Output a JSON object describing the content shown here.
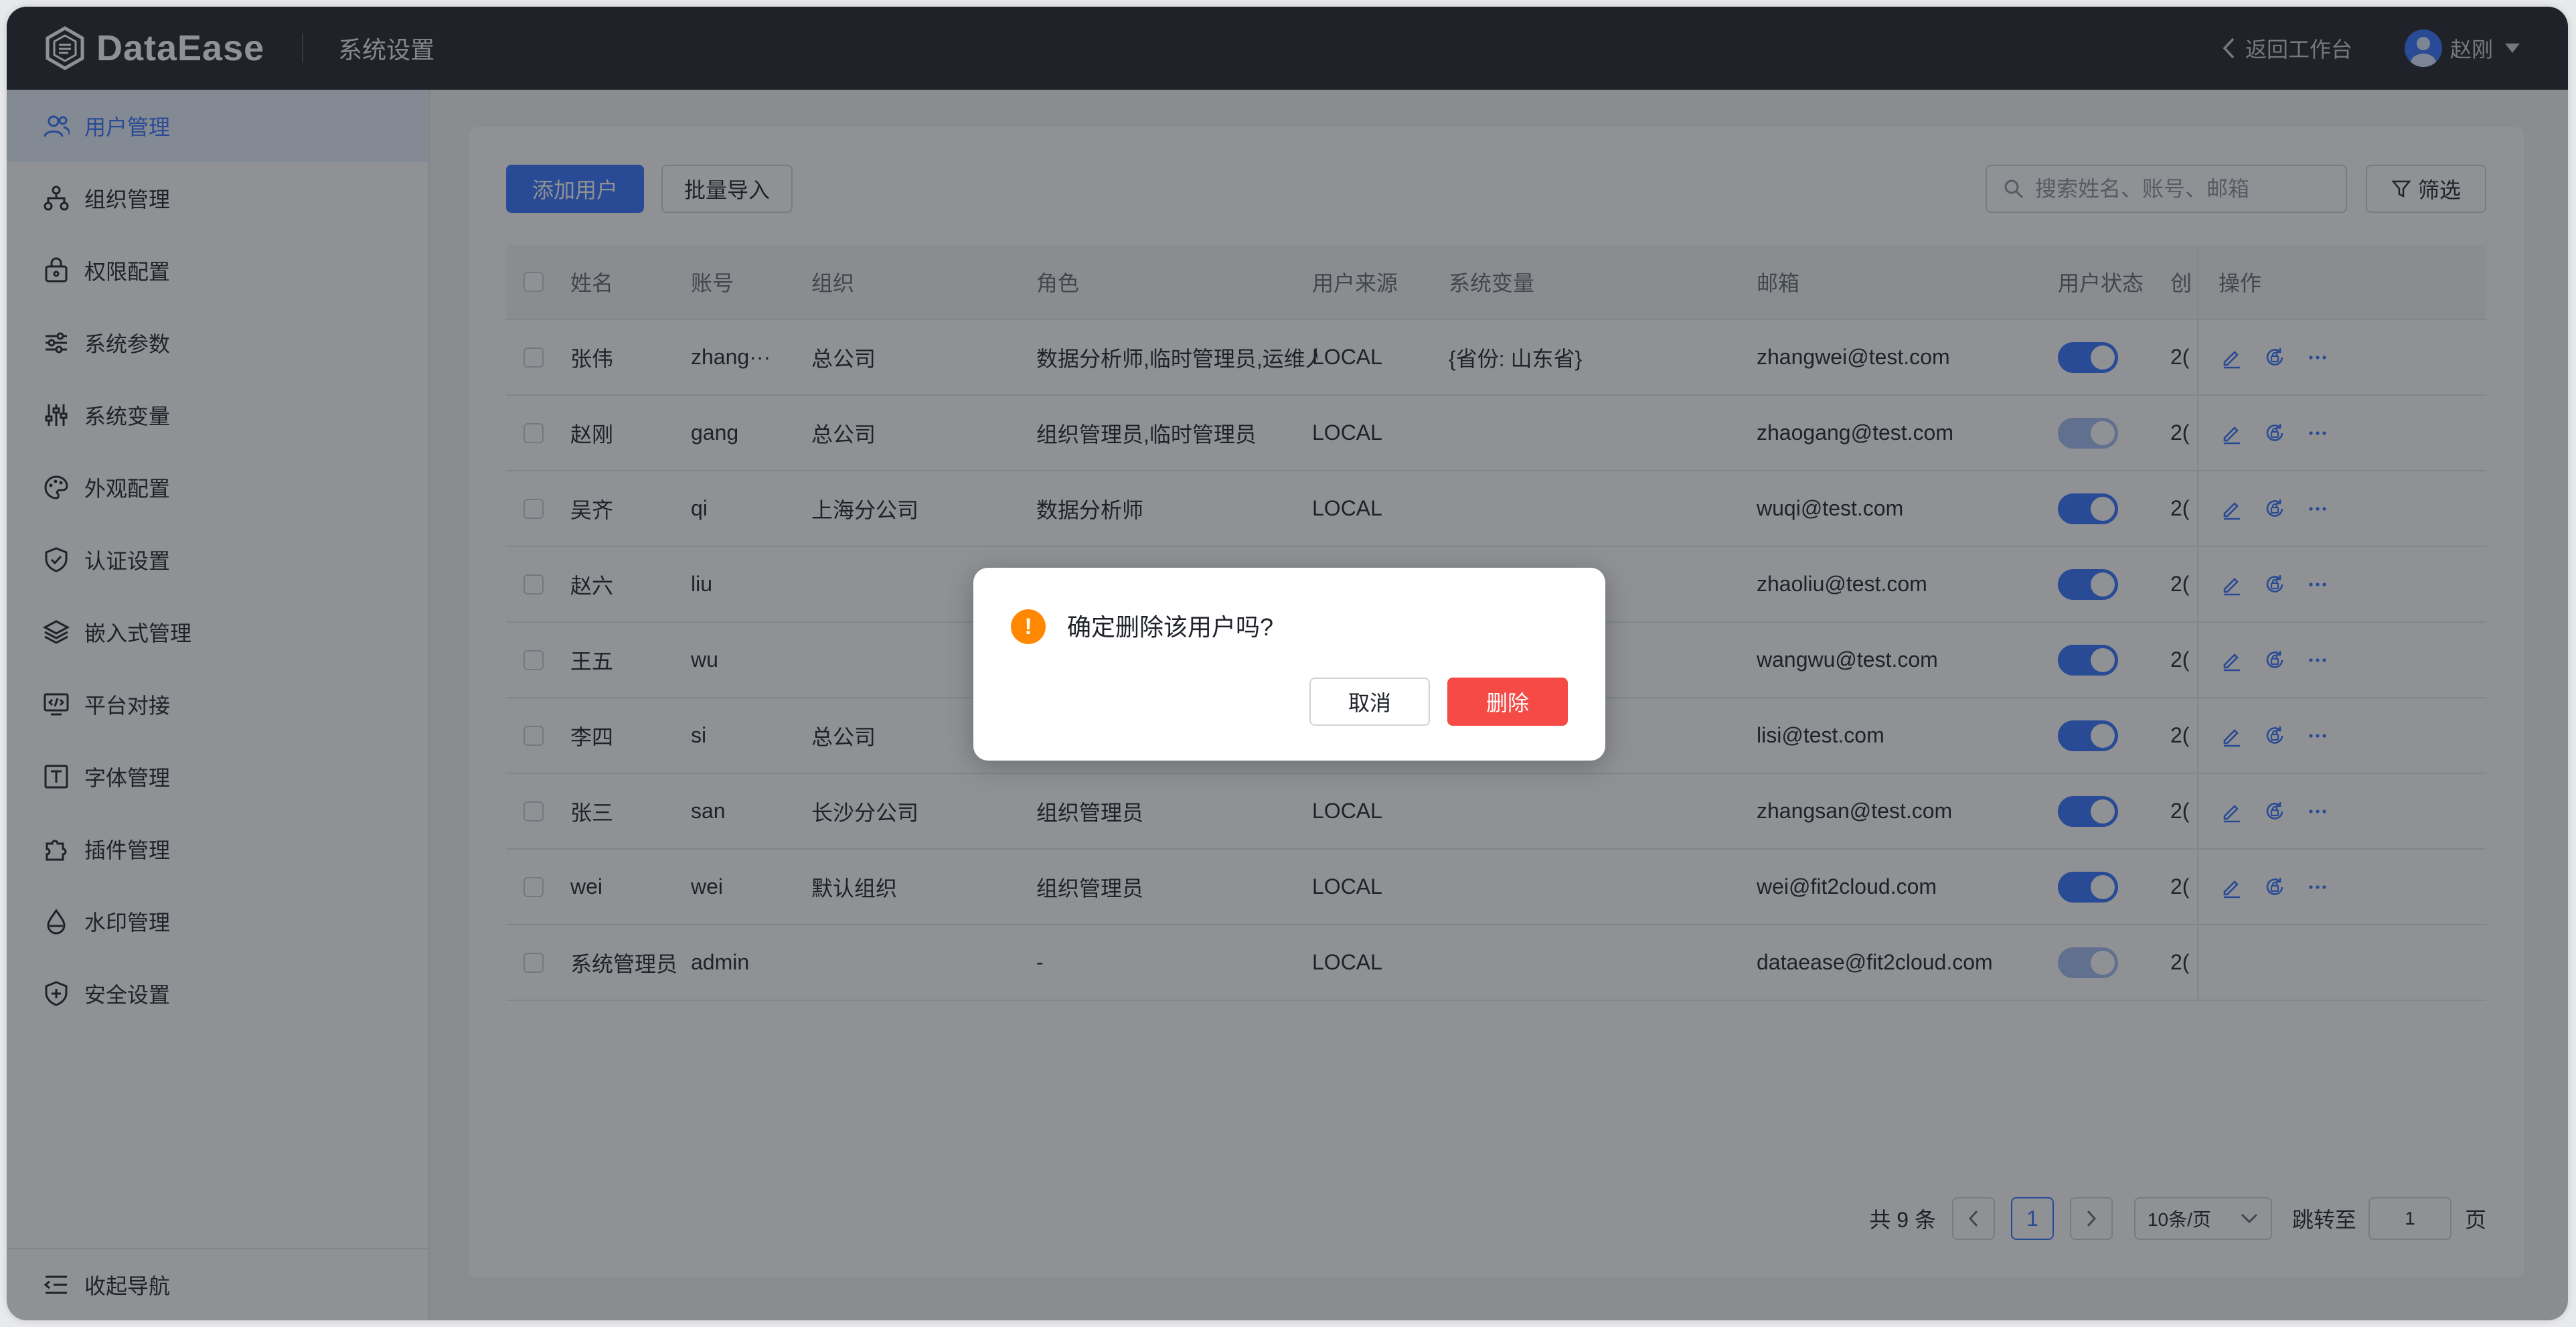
{
  "header": {
    "logo_text": "DataEase",
    "title": "系统设置",
    "back_label": "返回工作台",
    "user_name": "赵刚"
  },
  "sidebar": {
    "items": [
      {
        "label": "用户管理",
        "icon": "users-icon",
        "active": true
      },
      {
        "label": "组织管理",
        "icon": "org-tree-icon"
      },
      {
        "label": "权限配置",
        "icon": "lock-bag-icon"
      },
      {
        "label": "系统参数",
        "icon": "sliders-icon"
      },
      {
        "label": "系统变量",
        "icon": "equalizer-icon"
      },
      {
        "label": "外观配置",
        "icon": "palette-icon"
      },
      {
        "label": "认证设置",
        "icon": "shield-check-icon"
      },
      {
        "label": "嵌入式管理",
        "icon": "layers-icon"
      },
      {
        "label": "平台对接",
        "icon": "monitor-code-icon"
      },
      {
        "label": "字体管理",
        "icon": "font-icon"
      },
      {
        "label": "插件管理",
        "icon": "puzzle-icon"
      },
      {
        "label": "水印管理",
        "icon": "drop-icon"
      },
      {
        "label": "安全设置",
        "icon": "shield-plus-icon"
      }
    ],
    "collapse_label": "收起导航"
  },
  "toolbar": {
    "add_label": "添加用户",
    "import_label": "批量导入",
    "search_placeholder": "搜索姓名、账号、邮箱",
    "filter_label": "筛选"
  },
  "table": {
    "headers": {
      "name": "姓名",
      "account": "账号",
      "org": "组织",
      "role": "角色",
      "source": "用户来源",
      "vars": "系统变量",
      "email": "邮箱",
      "status": "用户状态",
      "created": "创",
      "ops": "操作"
    },
    "rows": [
      {
        "name": "张伟",
        "account": "zhang···",
        "org": "总公司",
        "role": "数据分析师,临时管理员,运维人",
        "source": "LOCAL",
        "vars": "{省份: 山东省}",
        "email": "zhangwei@test.com",
        "enabled": true,
        "created": "2(",
        "ops": true
      },
      {
        "name": "赵刚",
        "account": "gang",
        "org": "总公司",
        "role": "组织管理员,临时管理员",
        "source": "LOCAL",
        "vars": "",
        "email": "zhaogang@test.com",
        "enabled": true,
        "locked": true,
        "created": "2(",
        "ops": true
      },
      {
        "name": "吴齐",
        "account": "qi",
        "org": "上海分公司",
        "role": "数据分析师",
        "source": "LOCAL",
        "vars": "",
        "email": "wuqi@test.com",
        "enabled": true,
        "created": "2(",
        "ops": true
      },
      {
        "name": "赵六",
        "account": "liu",
        "org": "",
        "role": "",
        "source": "",
        "vars": "",
        "email": "zhaoliu@test.com",
        "enabled": true,
        "created": "2(",
        "ops": true
      },
      {
        "name": "王五",
        "account": "wu",
        "org": "",
        "role": "",
        "source": "",
        "vars": "",
        "email": "wangwu@test.com",
        "enabled": true,
        "created": "2(",
        "ops": true
      },
      {
        "name": "李四",
        "account": "si",
        "org": "总公司",
        "role": "",
        "source": "",
        "vars": "",
        "email": "lisi@test.com",
        "enabled": true,
        "created": "2(",
        "ops": true
      },
      {
        "name": "张三",
        "account": "san",
        "org": "长沙分公司",
        "role": "组织管理员",
        "source": "LOCAL",
        "vars": "",
        "email": "zhangsan@test.com",
        "enabled": true,
        "created": "2(",
        "ops": true
      },
      {
        "name": "wei",
        "account": "wei",
        "org": "默认组织",
        "role": "组织管理员",
        "source": "LOCAL",
        "vars": "",
        "email": "wei@fit2cloud.com",
        "enabled": true,
        "created": "2(",
        "ops": true
      },
      {
        "name": "系统管理员",
        "account": "admin",
        "org": "",
        "role": "-",
        "source": "LOCAL",
        "vars": "",
        "email": "dataease@fit2cloud.com",
        "enabled": true,
        "locked": true,
        "created": "2(",
        "ops": false
      }
    ]
  },
  "pagination": {
    "total_label": "共 9 条",
    "current_page": "1",
    "page_size": "10条/页",
    "jump_label": "跳转至",
    "jump_value": "1",
    "unit_label": "页"
  },
  "dialog": {
    "icon_glyph": "!",
    "message": "确定删除该用户吗?",
    "cancel_label": "取消",
    "delete_label": "删除"
  },
  "colors": {
    "primary": "#3370ff",
    "danger": "#f54a45",
    "warning": "#ff8800",
    "header_bg": "#1f2329"
  }
}
